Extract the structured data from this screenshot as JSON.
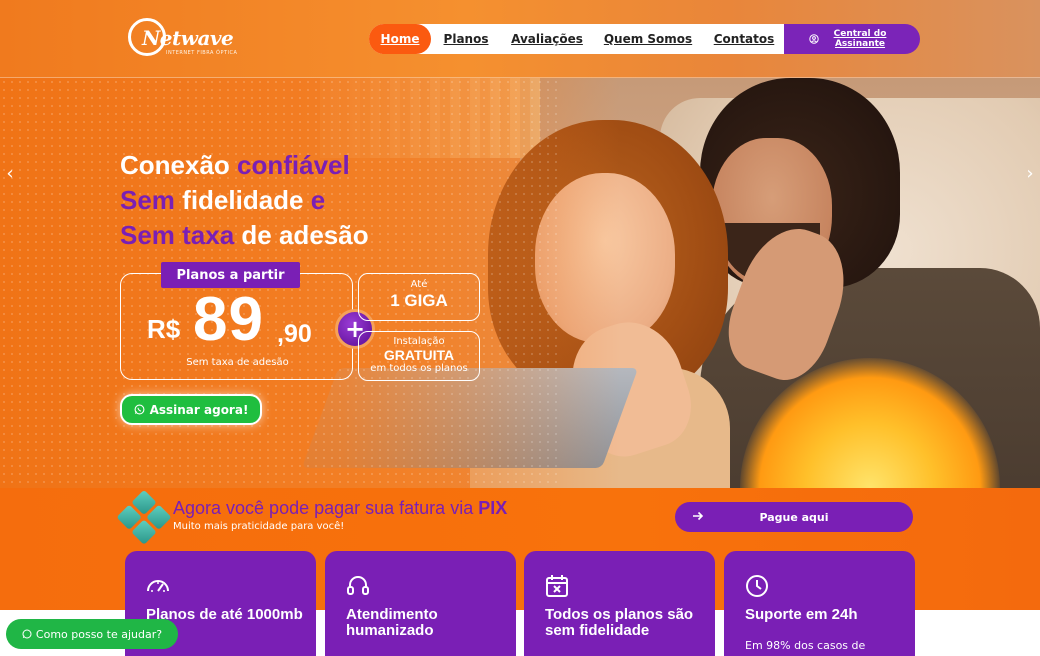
{
  "header": {
    "logo_text": "Netwave",
    "logo_sub": "INTERNET FIBRA ÓPTICA",
    "nav": [
      {
        "label": "Home",
        "active": true
      },
      {
        "label": "Planos"
      },
      {
        "label": "Avaliações"
      },
      {
        "label": "Quem Somos"
      },
      {
        "label": "Contatos"
      }
    ],
    "central_label": "Central do Assinante"
  },
  "hero": {
    "headline": {
      "line1a": "Conexão ",
      "line1b": "confiável",
      "line2a": "Sem ",
      "line2b": "fidelidade ",
      "line2c": "e",
      "line3a": "Sem taxa ",
      "line3b": "de adesão"
    },
    "price_tag": "Planos a partir",
    "currency": "R$",
    "price_main": "89",
    "price_cents": ",90",
    "price_note": "Sem taxa de adesão",
    "plus": "+",
    "speed_small": "Até",
    "speed_big": "1 GIGA",
    "install_small": "Instalação",
    "install_big": "GRATUITA",
    "install_note": "em todos os planos",
    "cta_label": "Assinar agora!",
    "arrow_left": "‹",
    "arrow_right": "›"
  },
  "pix": {
    "title_a": "Agora você pode pagar sua fatura via ",
    "title_b": "PIX",
    "subtitle": "Muito mais praticidade para você!",
    "button_label": "Pague aqui"
  },
  "cards": [
    {
      "icon": "speedometer-icon",
      "title": "Planos de até 1000mb",
      "text": ""
    },
    {
      "icon": "headset-icon",
      "title": "Atendimento humanizado",
      "text": ""
    },
    {
      "icon": "calendar-x-icon",
      "title": "Todos os planos são sem fidelidade",
      "text": ""
    },
    {
      "icon": "clock-icon",
      "title": "Suporte em 24h",
      "text": "Em 98% dos casos de"
    }
  ],
  "help": {
    "label": "Como posso te ajudar?"
  },
  "colors": {
    "orange": "#f8720c",
    "purple": "#7a1fb5",
    "green": "#1fbe3f"
  }
}
